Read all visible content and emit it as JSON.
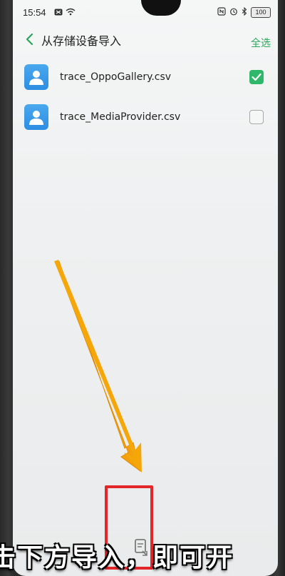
{
  "status_bar": {
    "time": "15:54",
    "battery": "100",
    "icons": [
      "notification-icon",
      "wifi-icon",
      "nfc-icon",
      "alarm-icon",
      "bluetooth-icon"
    ]
  },
  "header": {
    "title": "从存储设备导入",
    "select_all_label": "全选",
    "back_icon": "chevron-left-icon"
  },
  "files": [
    {
      "name": "trace_OppoGallery.csv",
      "checked": true
    },
    {
      "name": "trace_MediaProvider.csv",
      "checked": false
    }
  ],
  "caption": "击下方导入，即可开",
  "colors": {
    "accent": "#29a85b",
    "checkbox_checked": "#2fb76a",
    "file_icon": "#3a9be8",
    "arrow": "#f5a70a",
    "highlight": "#e3262a"
  }
}
